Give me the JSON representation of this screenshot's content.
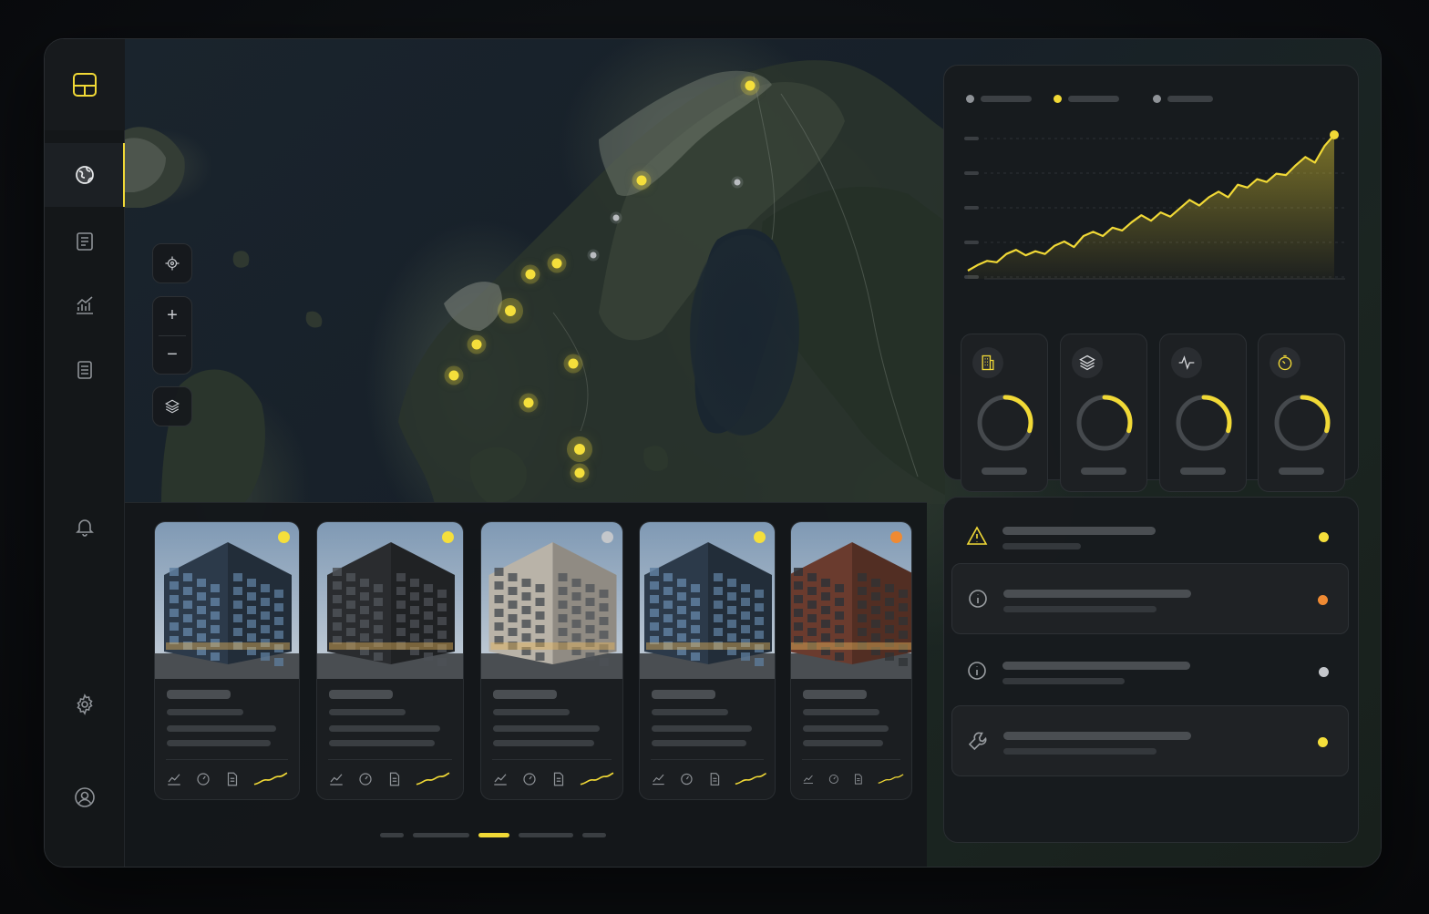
{
  "colors": {
    "accent": "#f1d936",
    "pin_yellow": "#f5df3b",
    "pin_gray": "#b9bcc0",
    "status_orange": "#ef8a33",
    "status_gray": "#c4c7cb",
    "panel_bg": "#181b1e",
    "frame_bg": "#15181b"
  },
  "sidebar": {
    "logo_icon": "layout-icon",
    "items": [
      {
        "icon": "globe-icon",
        "active": true
      },
      {
        "icon": "ledger-icon",
        "active": false
      },
      {
        "icon": "analytics-icon",
        "active": false
      },
      {
        "icon": "document-icon",
        "active": false
      },
      {
        "icon": "bell-icon",
        "active": false
      },
      {
        "icon": "gear-icon",
        "active": false
      },
      {
        "icon": "user-icon",
        "active": false
      }
    ]
  },
  "map": {
    "controls": [
      "locate-icon",
      "zoom-in-icon",
      "zoom-out-icon",
      "layers-icon"
    ],
    "zoom_in_symbol": "+",
    "zoom_out_symbol": "−"
  },
  "properties": [
    {
      "status": "yellow",
      "style": "glass"
    },
    {
      "status": "yellow",
      "style": "dark"
    },
    {
      "status": "gray",
      "style": "residential"
    },
    {
      "status": "yellow",
      "style": "glass"
    },
    {
      "status": "orange",
      "style": "brick"
    }
  ],
  "pager": {
    "count": 5,
    "active": 2
  },
  "chart_data": {
    "type": "area",
    "title": "",
    "xlabel": "",
    "ylabel": "",
    "legend": [
      "",
      "",
      ""
    ],
    "grid": true,
    "y": [
      2,
      6,
      9,
      8,
      14,
      17,
      13,
      16,
      14,
      20,
      23,
      19,
      27,
      30,
      27,
      33,
      31,
      37,
      42,
      38,
      44,
      41,
      47,
      53,
      49,
      55,
      59,
      55,
      64,
      62,
      68,
      66,
      72,
      71,
      78,
      84,
      80,
      92,
      100
    ]
  },
  "kpis": [
    {
      "icon": "building-icon",
      "progress": 0.3
    },
    {
      "icon": "layers-icon",
      "progress": 0.3
    },
    {
      "icon": "pulse-icon",
      "progress": 0.3
    },
    {
      "icon": "timer-icon",
      "progress": 0.3
    }
  ],
  "alerts": [
    {
      "icon": "warning-icon",
      "status": "yellow",
      "boxed": false
    },
    {
      "icon": "info-icon",
      "status": "orange",
      "boxed": true
    },
    {
      "icon": "info-icon",
      "status": "gray",
      "boxed": false
    },
    {
      "icon": "wrench-icon",
      "status": "yellow",
      "boxed": true
    }
  ]
}
